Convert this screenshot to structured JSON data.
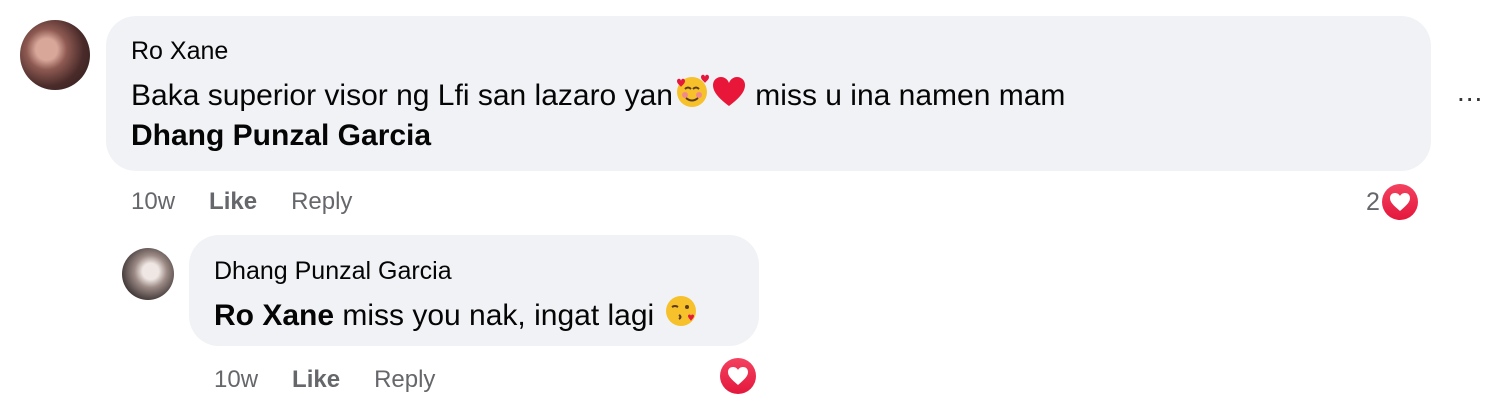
{
  "comment": {
    "author": "Ro Xane",
    "text": "Baka superior visor ng Lfi san lazaro yan",
    "text_after_emoji": " miss u ina namen mam",
    "mention": "Dhang Punzal Garcia",
    "time": "10w",
    "like_label": "Like",
    "reply_label": "Reply",
    "reaction_count": "2",
    "more_label": "..."
  },
  "reply": {
    "author": "Dhang Punzal Garcia",
    "mention": "Ro Xane",
    "text": " miss you nak, ingat lagi ",
    "time": "10w",
    "like_label": "Like",
    "reply_label": "Reply"
  },
  "colors": {
    "bubble": "#f0f2f5",
    "meta_text": "#65676b",
    "reaction_red": "#e4173d"
  }
}
